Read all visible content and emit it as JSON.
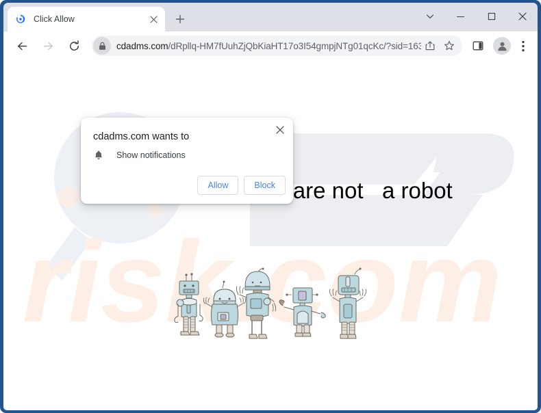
{
  "window": {
    "controls": [
      {
        "name": "tab-search",
        "icon": "chevron-down-icon",
        "label": "⌄"
      },
      {
        "name": "minimize",
        "icon": "minimize-icon",
        "label": "−"
      },
      {
        "name": "maximize",
        "icon": "maximize-icon",
        "label": "□"
      },
      {
        "name": "close",
        "icon": "close-icon",
        "label": "✕"
      }
    ],
    "frame_color": "#24548f"
  },
  "tabstrip": {
    "tab_title": "Click Allow",
    "favicon": "chrome-refresh-favicon",
    "close_label": "✕",
    "new_tab_label": "+"
  },
  "toolbar": {
    "back_label": "←",
    "forward_label": "→",
    "reload_label": "↻",
    "lock_icon": "lock-icon",
    "url_host": "cdadms.com",
    "url_path": "/dRpllq-HM7fUuhZjQbKiaHT17o3I54gmpjNTg01qcKc/?sid=163…",
    "url_full": "cdadms.com/dRpllq-HM7fUuhZjQbKiaHT17o3I54gmpjNTg01qcKc/?sid=163…",
    "share_icon": "share-icon",
    "bookmark_icon": "star-icon",
    "side_panel_icon": "side-panel-icon",
    "avatar_icon": "profile-avatar-icon",
    "menu_icon": "three-dot-menu-icon"
  },
  "permission_dialog": {
    "title": "cdadms.com wants to",
    "item_icon": "bell-icon",
    "item_label": "Show notifications",
    "allow_label": "Allow",
    "block_label": "Block",
    "close_label": "✕",
    "accent_color": "#4285f4"
  },
  "page": {
    "headline": "Click \"Allow\"   if you are not   a robot",
    "illustration": "five-cartoon-robots",
    "watermark_top": "PC",
    "watermark_bottom": "risk.com",
    "watermark_top_color": "#eceef1",
    "watermark_bottom_color": "#fdeee6",
    "background_color": "#ffffff"
  }
}
